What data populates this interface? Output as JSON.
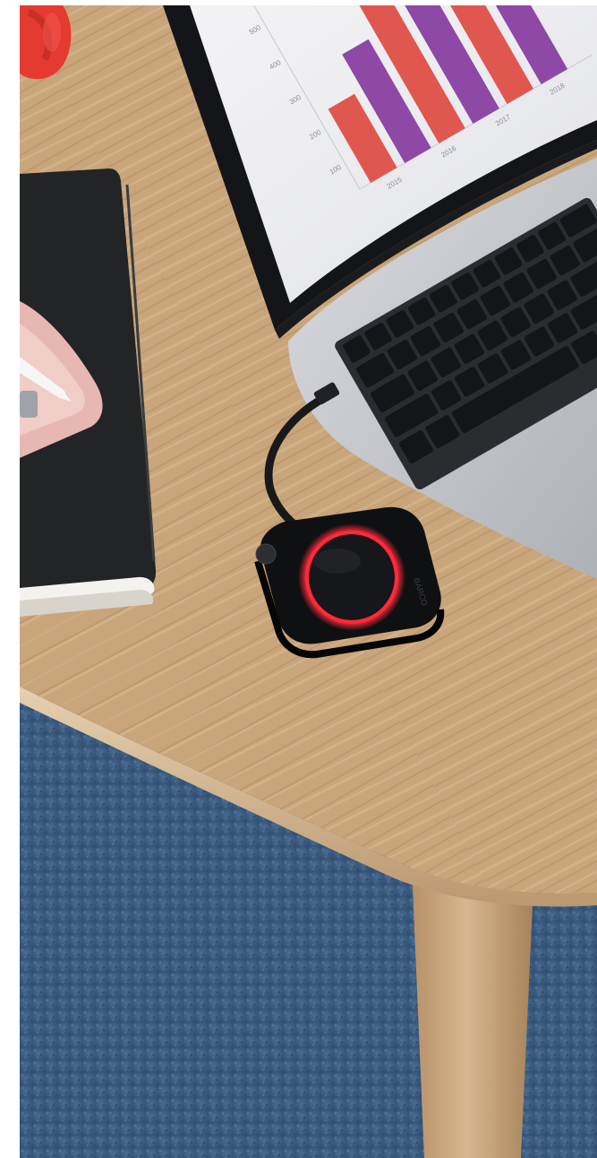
{
  "photo": {
    "laptop_screen_chart": {
      "y_ticks": [
        "500",
        "400",
        "300",
        "200",
        "100"
      ],
      "x_ticks": [
        "2015",
        "2016",
        "2017",
        "2018"
      ],
      "series_colors": [
        "#e0574f",
        "#8e48a6"
      ]
    },
    "dongle": {
      "ring_color": "#ff2a3a",
      "logo_text": "BARCO"
    },
    "colors": {
      "table_wood": "#c9a57b",
      "carpet_blue": "#3d5f86",
      "notebook_black": "#222426",
      "tray_pink": "#e7b8b3",
      "laptop_silver": "#c9cbcf",
      "mug_red": "#e43a30"
    }
  }
}
